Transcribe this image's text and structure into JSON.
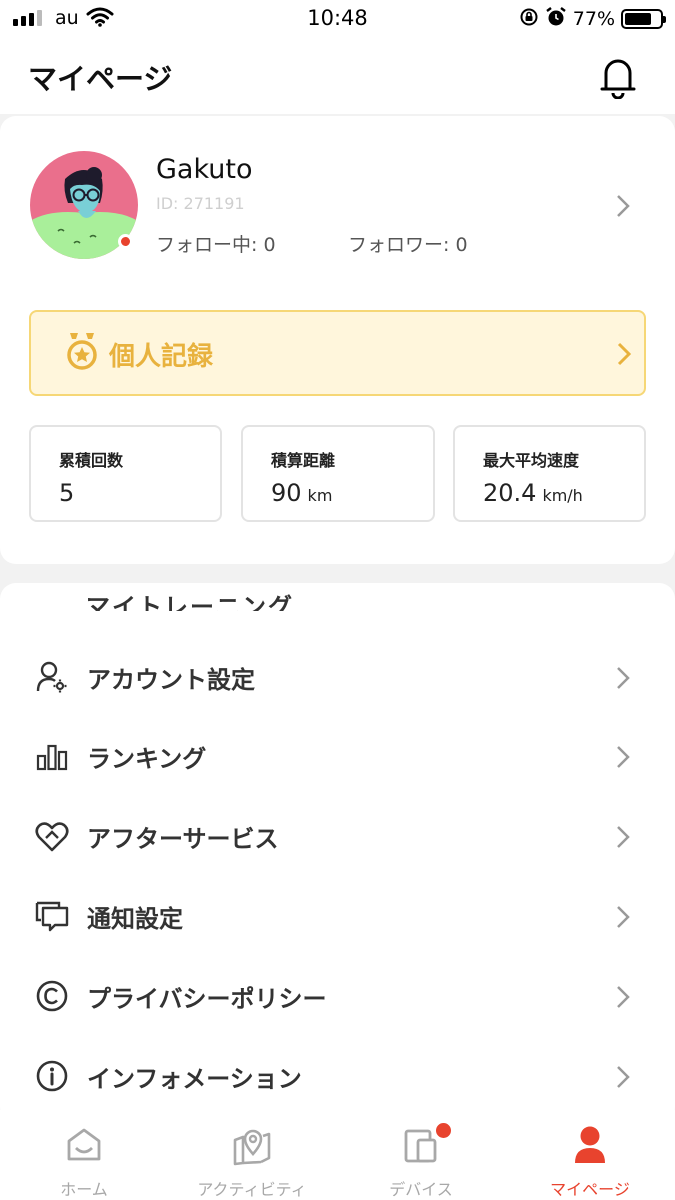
{
  "status_bar": {
    "carrier": "au",
    "time": "10:48",
    "battery_percent": "77%",
    "battery_level": 0.77
  },
  "header": {
    "title": "マイページ",
    "notification_icon": "bell-icon"
  },
  "profile": {
    "name": "Gakuto",
    "id": "ID: 271191",
    "following": "フォロー中: 0",
    "followers": "フォロワー: 0",
    "online": true
  },
  "records_banner": {
    "label": "個人記録",
    "icon": "medal-icon"
  },
  "stats": [
    {
      "label": "累積回数",
      "value": "5",
      "unit": ""
    },
    {
      "label": "積算距離",
      "value": "90",
      "unit": "km"
    },
    {
      "label": "最大平均速度",
      "value": "20.4",
      "unit": "km/h"
    }
  ],
  "menu": {
    "clipped_item": "マイトレーニング",
    "items": [
      {
        "label": "アカウント設定",
        "icon": "account-settings-icon"
      },
      {
        "label": "ランキング",
        "icon": "ranking-icon"
      },
      {
        "label": "アフターサービス",
        "icon": "after-service-icon"
      },
      {
        "label": "通知設定",
        "icon": "notification-settings-icon"
      },
      {
        "label": "プライバシーポリシー",
        "icon": "copyright-icon"
      },
      {
        "label": "インフォメーション",
        "icon": "info-icon"
      }
    ]
  },
  "bottom_nav": {
    "items": [
      {
        "label": "ホーム",
        "icon": "home-icon",
        "active": false
      },
      {
        "label": "アクティビティ",
        "icon": "activity-map-icon",
        "active": false
      },
      {
        "label": "デバイス",
        "icon": "device-icon",
        "active": false,
        "badge": true
      },
      {
        "label": "マイページ",
        "icon": "person-icon",
        "active": true
      }
    ]
  },
  "colors": {
    "accent": "#e8432e",
    "records_text": "#e8b23e",
    "records_bg": "#fff6dc",
    "records_border": "#f6d776"
  }
}
